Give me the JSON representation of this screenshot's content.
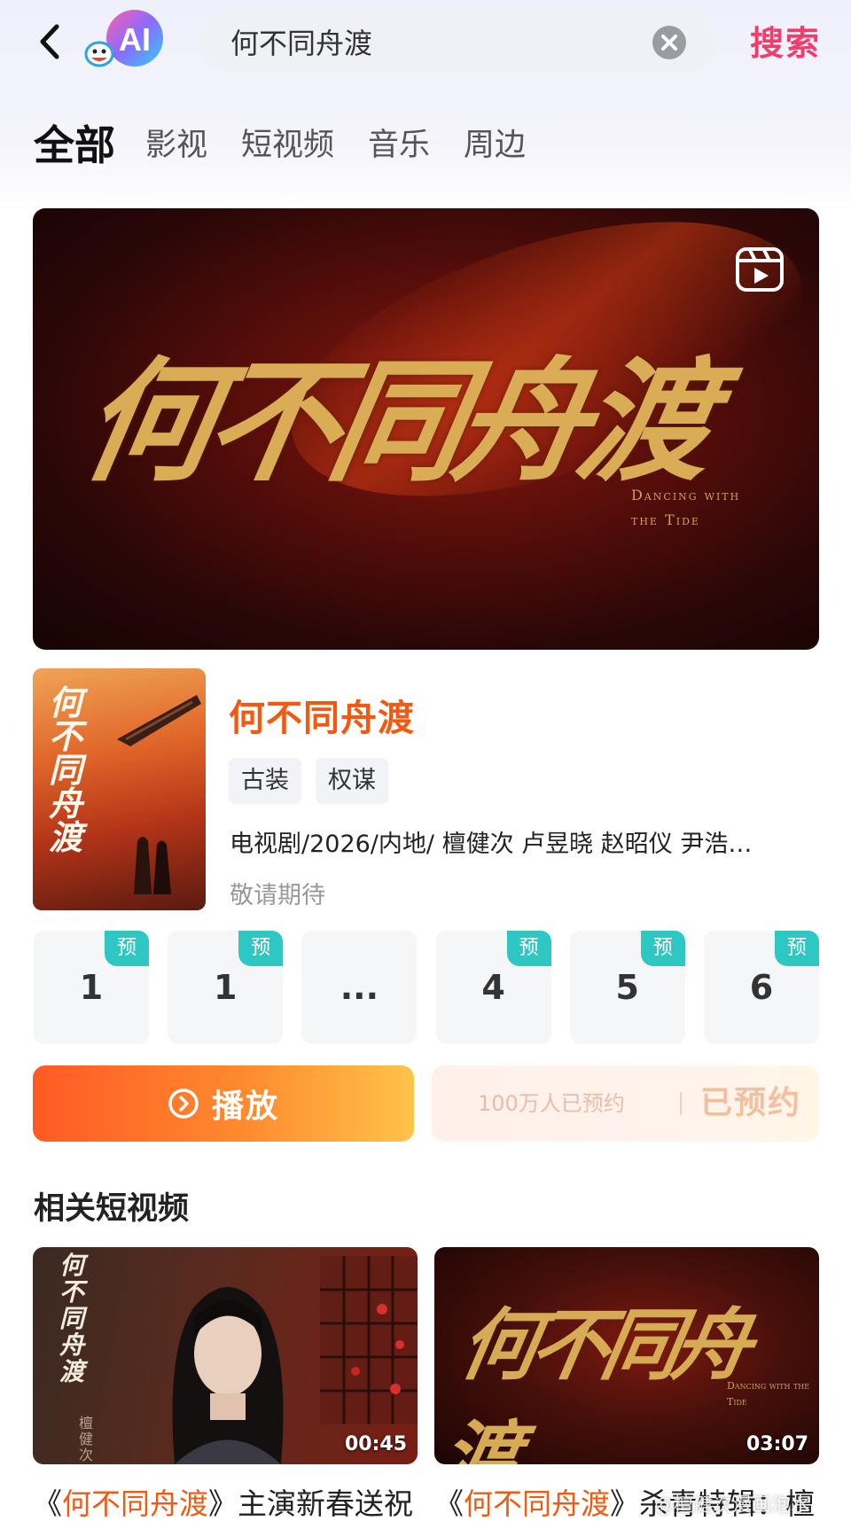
{
  "header": {
    "search_value": "何不同舟渡",
    "search_button_label": "搜索"
  },
  "tabs": [
    {
      "label": "全部",
      "active": true
    },
    {
      "label": "影视",
      "active": false
    },
    {
      "label": "短视频",
      "active": false
    },
    {
      "label": "音乐",
      "active": false
    },
    {
      "label": "周边",
      "active": false
    }
  ],
  "hero": {
    "title_art": "何不同舟渡",
    "subtitle_art": "Dancing with the Tide"
  },
  "show": {
    "title": "何不同舟渡",
    "tags": [
      "古装",
      "权谋"
    ],
    "meta": "电视剧/2026/内地/ 檀健次 卢昱晓 赵昭仪 尹浩…",
    "status": "敬请期待",
    "poster_title_art": "何不同舟渡"
  },
  "episodes": [
    {
      "label": "1",
      "badge": "预"
    },
    {
      "label": "1",
      "badge": "预"
    },
    {
      "label": "...",
      "badge": ""
    },
    {
      "label": "4",
      "badge": "预"
    },
    {
      "label": "5",
      "badge": "预"
    },
    {
      "label": "6",
      "badge": "预"
    }
  ],
  "actions": {
    "play_label": "播放",
    "reserve_count": "100万人已预约",
    "reserve_label": "已预约"
  },
  "related": {
    "section_title": "相关短视频",
    "items": [
      {
        "duration": "00:45",
        "caption_open": "《",
        "caption_hl": "何不同舟渡",
        "caption_rest": "》主演新春送祝",
        "art_title": "何不同舟渡",
        "art_name": "檀健次"
      },
      {
        "duration": "03:07",
        "caption_open": "《",
        "caption_hl": "何不同舟渡",
        "caption_rest": "》杀青特辑：檀",
        "art_title": "何不同舟渡",
        "art_sub": "Dancing with the Tide"
      }
    ]
  },
  "watermark": "@檀健次漫画泡水",
  "colors": {
    "accent_orange": "#f25a14",
    "search_pink": "#f23c6b",
    "badge_teal": "#2ec7c4"
  }
}
